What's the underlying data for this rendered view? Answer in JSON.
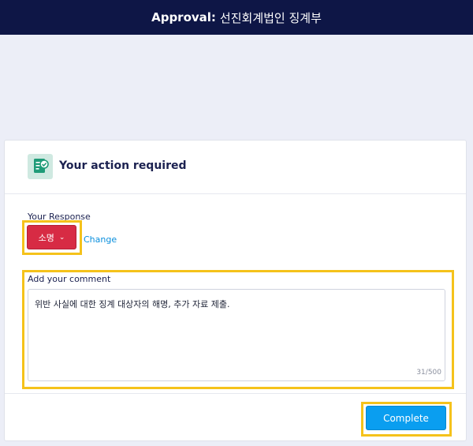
{
  "header": {
    "title_bold": "Approval:",
    "title_rest": "선진회계법인 징계부"
  },
  "card": {
    "icon": "approval-document-check-icon",
    "title": "Your action required"
  },
  "response": {
    "label": "Your Response",
    "selected": "소명",
    "change_label": "Change"
  },
  "comment": {
    "label": "Add your comment",
    "value": "위반 사실에 대한 징계 대상자의 해명, 추가 자료 제출.",
    "char_count": "31/500"
  },
  "footer": {
    "complete_label": "Complete"
  },
  "colors": {
    "header_bg": "#0e1646",
    "response_bg": "#d72b44",
    "link": "#0a8fdd",
    "complete_bg": "#0a9ef0",
    "highlight": "#f5c21b"
  }
}
